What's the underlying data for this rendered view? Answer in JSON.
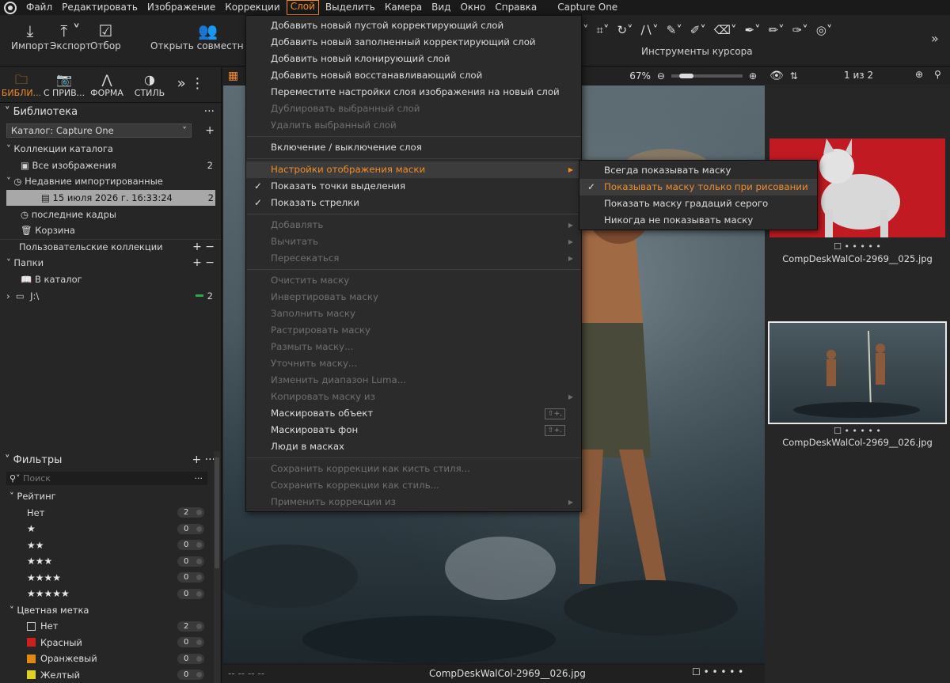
{
  "menubar": {
    "items": [
      "Файл",
      "Редактировать",
      "Изображение",
      "Коррекции",
      "Слой",
      "Выделить",
      "Камера",
      "Вид",
      "Окно",
      "Справка"
    ],
    "active_index": 4,
    "app_title": "Capture One"
  },
  "toolbar": {
    "import": "Импорт",
    "export": "Экспорт",
    "select": "Отбор",
    "share": "Открыть совместный д",
    "cursor_tools_label": "Инструменты курсора"
  },
  "left_tabs": [
    "БИБЛИ...",
    "С ПРИВ...",
    "ФОРМА",
    "СТИЛЬ"
  ],
  "library": {
    "title": "Библиотека",
    "catalog": "Каталог: Capture One",
    "catalog_collections": "Коллекции каталога",
    "all_images": "Все изображения",
    "all_images_count": "2",
    "recent_imports": "Недавние импортированные",
    "import_date": "15 июля 2026 г. 16:33:24",
    "import_date_count": "2",
    "recent_captures": "последние кадры",
    "trash": "Корзина",
    "user_collections": "Пользовательские коллекции",
    "folders": "Папки",
    "in_catalog": "В каталог",
    "drive": "J:\\",
    "drive_count": "2"
  },
  "filters": {
    "title": "Фильтры",
    "search_placeholder": "Поиск",
    "rating_title": "Рейтинг",
    "rating_rows": [
      {
        "label": "Нет",
        "count": "2"
      },
      {
        "label": "★",
        "count": "0"
      },
      {
        "label": "★★",
        "count": "0"
      },
      {
        "label": "★★★",
        "count": "0"
      },
      {
        "label": "★★★★",
        "count": "0"
      },
      {
        "label": "★★★★★",
        "count": "0"
      }
    ],
    "color_title": "Цветная метка",
    "color_rows": [
      {
        "label": "Нет",
        "count": "2",
        "color": "none"
      },
      {
        "label": "Красный",
        "count": "0",
        "color": "#cc2020"
      },
      {
        "label": "Оранжевый",
        "count": "0",
        "color": "#e08a10"
      },
      {
        "label": "Желтый",
        "count": "0",
        "color": "#e0d020"
      }
    ]
  },
  "viewer": {
    "zoom": "67%",
    "filename": "CompDeskWalCol-2969__026.jpg",
    "bottom_left": "--   --   --   --"
  },
  "browser": {
    "counter": "1 из 2",
    "thumbs": [
      "CompDeskWalCol-2969__025.jpg",
      "CompDeskWalCol-2969__026.jpg"
    ]
  },
  "layer_menu": {
    "items": [
      {
        "label": "Добавить новый пустой корректирующий слой",
        "state": "normal"
      },
      {
        "label": "Добавить новый заполненный корректирующий слой",
        "state": "normal"
      },
      {
        "label": "Добавить новый клонирующий слой",
        "state": "normal"
      },
      {
        "label": "Добавить новый восстанавливающий слой",
        "state": "normal"
      },
      {
        "label": "Переместите настройки слоя изображения на новый слой",
        "state": "normal"
      },
      {
        "label": "Дублировать выбранный слой",
        "state": "disabled"
      },
      {
        "label": "Удалить выбранный слой",
        "state": "disabled"
      },
      {
        "sep": true
      },
      {
        "label": "Включение / выключение слоя",
        "state": "normal"
      },
      {
        "sep": true
      },
      {
        "label": "Настройки отображения маски",
        "state": "highlight",
        "submenu": true
      },
      {
        "label": "Показать точки выделения",
        "state": "normal",
        "checked": true
      },
      {
        "label": "Показать стрелки",
        "state": "normal",
        "checked": true
      },
      {
        "sep": true
      },
      {
        "label": "Добавлять",
        "state": "disabled",
        "submenu": true
      },
      {
        "label": "Вычитать",
        "state": "disabled",
        "submenu": true
      },
      {
        "label": "Пересекаться",
        "state": "disabled",
        "submenu": true
      },
      {
        "sep": true
      },
      {
        "label": "Очистить маску",
        "state": "disabled"
      },
      {
        "label": "Инвертировать маску",
        "state": "disabled"
      },
      {
        "label": "Заполнить маску",
        "state": "disabled"
      },
      {
        "label": "Растрировать маску",
        "state": "disabled"
      },
      {
        "label": "Размыть маску...",
        "state": "disabled"
      },
      {
        "label": "Уточнить маску...",
        "state": "disabled"
      },
      {
        "label": "Изменить диапазон Luma...",
        "state": "disabled"
      },
      {
        "label": "Копировать маску из",
        "state": "disabled",
        "submenu": true
      },
      {
        "label": "Маскировать объект",
        "state": "normal",
        "shortcut": "⇧+,"
      },
      {
        "label": "Маскировать фон",
        "state": "normal",
        "shortcut": "⇧+."
      },
      {
        "label": "Люди в масках",
        "state": "normal"
      },
      {
        "sep": true
      },
      {
        "label": "Сохранить коррекции как кисть стиля...",
        "state": "disabled"
      },
      {
        "label": "Сохранить коррекции как стиль...",
        "state": "disabled"
      },
      {
        "label": "Применить коррекции из",
        "state": "disabled",
        "submenu": true
      }
    ]
  },
  "mask_submenu": {
    "items": [
      {
        "label": "Всегда показывать маску",
        "checked": false
      },
      {
        "label": "Показывать маску только при рисовании",
        "checked": true
      },
      {
        "label": "Показать маску градаций серого",
        "checked": false
      },
      {
        "label": "Никогда не показывать маску",
        "checked": false
      }
    ]
  },
  "colors": {
    "accent": "#f28c28"
  }
}
